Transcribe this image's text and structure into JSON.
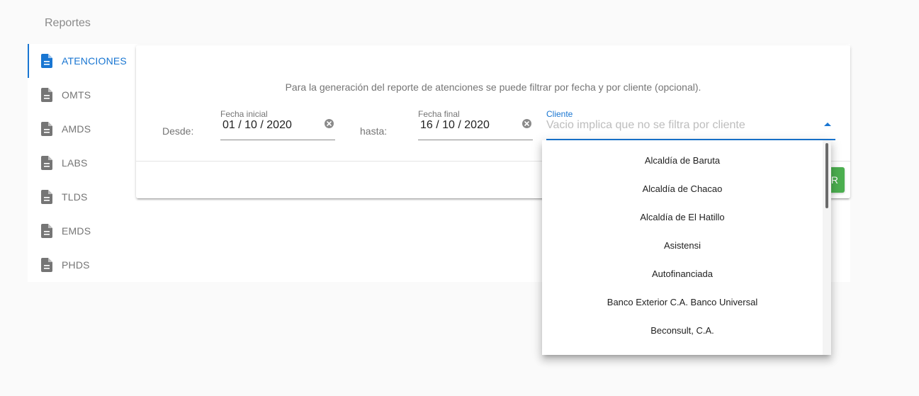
{
  "page": {
    "title": "Reportes"
  },
  "sidebar": {
    "items": [
      {
        "label": "ATENCIONES",
        "active": true
      },
      {
        "label": "OMTS",
        "active": false
      },
      {
        "label": "AMDS",
        "active": false
      },
      {
        "label": "LABS",
        "active": false
      },
      {
        "label": "TLDS",
        "active": false
      },
      {
        "label": "EMDS",
        "active": false
      },
      {
        "label": "PHDS",
        "active": false
      }
    ],
    "icon": "document-icon"
  },
  "form": {
    "description": "Para la generación del reporte de atenciones se puede filtrar por fecha y por cliente (opcional).",
    "desde_label": "Desde:",
    "hasta_label": "hasta:",
    "start_date": {
      "label": "Fecha inicial",
      "value": "01 / 10 / 2020"
    },
    "end_date": {
      "label": "Fecha final",
      "value": "16 / 10 / 2020"
    },
    "cliente": {
      "label": "Cliente",
      "placeholder": "Vacio implica que no se filtra por cliente"
    },
    "action_button_label": "R"
  },
  "dropdown": {
    "options": [
      "Alcaldía de Baruta",
      "Alcaldía de Chacao",
      "Alcaldía de El Hatillo",
      "Asistensi",
      "Autofinanciada",
      "Banco Exterior C.A. Banco Universal",
      "Beconsult, C.A."
    ]
  },
  "colors": {
    "accent": "#1976d2",
    "button": "#4caf50",
    "icon": "#757575"
  }
}
